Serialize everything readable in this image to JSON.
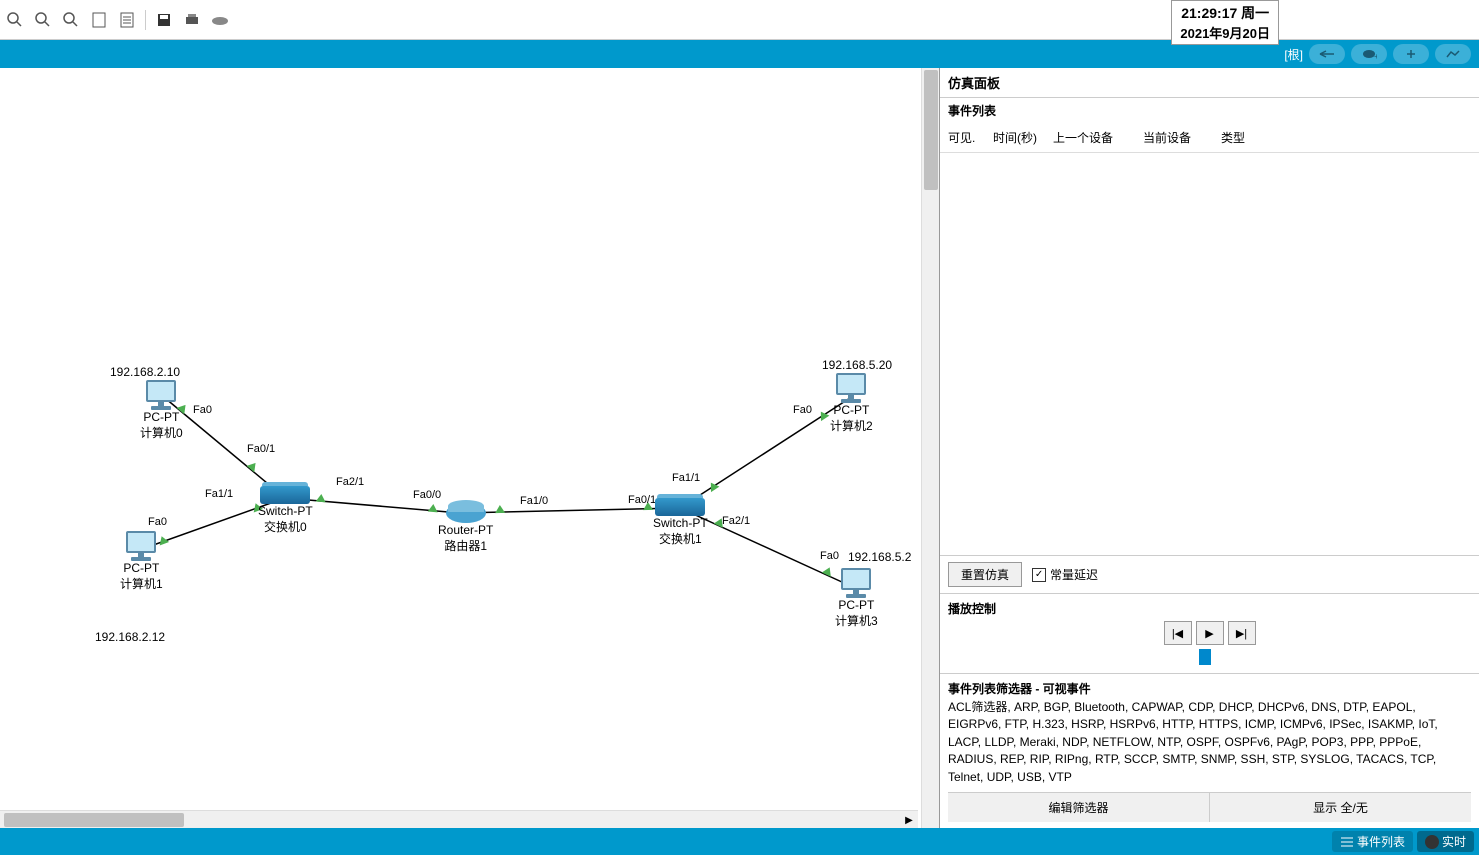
{
  "clock": {
    "time": "21:29:17 周一",
    "date": "2021年9月20日"
  },
  "blueBar": {
    "root": "[根]"
  },
  "devices": {
    "pc0": {
      "type": "PC-PT",
      "name": "计算机0",
      "ip": "192.168.2.10"
    },
    "pc1": {
      "type": "PC-PT",
      "name": "计算机1",
      "ip": "192.168.2.12"
    },
    "pc2": {
      "type": "PC-PT",
      "name": "计算机2",
      "ip": "192.168.5.20"
    },
    "pc3": {
      "type": "PC-PT",
      "name": "计算机3",
      "ip": "192.168.5.2"
    },
    "sw0": {
      "type": "Switch-PT",
      "name": "交换机0"
    },
    "sw1": {
      "type": "Switch-PT",
      "name": "交换机1"
    },
    "rt1": {
      "type": "Router-PT",
      "name": "路由器1"
    }
  },
  "ports": {
    "pc0_fa0": "Fa0",
    "pc1_fa0": "Fa0",
    "pc2_fa0": "Fa0",
    "pc3_fa0": "Fa0",
    "sw0_fa01": "Fa0/1",
    "sw0_fa11": "Fa1/1",
    "sw0_fa21": "Fa2/1",
    "sw1_fa01": "Fa0/1",
    "sw1_fa11": "Fa1/1",
    "sw1_fa21": "Fa2/1",
    "rt_fa00": "Fa0/0",
    "rt_fa10": "Fa1/0"
  },
  "sim": {
    "panelTitle": "仿真面板",
    "eventListTitle": "事件列表",
    "cols": {
      "visible": "可见.",
      "time": "时间(秒)",
      "prev": "上一个设备",
      "curr": "当前设备",
      "type": "类型"
    },
    "reset": "重置仿真",
    "constDelay": "常量延迟",
    "playTitle": "播放控制",
    "filterTitle": "事件列表筛选器 - 可视事件",
    "filterList": "ACL筛选器, ARP, BGP, Bluetooth, CAPWAP, CDP, DHCP, DHCPv6, DNS, DTP, EAPOL, EIGRPv6, FTP, H.323, HSRP, HSRPv6, HTTP, HTTPS, ICMP, ICMPv6, IPSec, ISAKMP, IoT, LACP, LLDP, Meraki, NDP, NETFLOW, NTP, OSPF, OSPFv6, PAgP, POP3, PPP, PPPoE, RADIUS, REP, RIP, RIPng, RTP, SCCP, SMTP, SNMP, SSH, STP, SYSLOG, TACACS, TCP, Telnet, UDP, USB, VTP",
    "editFilter": "编辑筛选器",
    "showAll": "显示 全/无"
  },
  "bottomBar": {
    "eventList": "事件列表",
    "realtime": "实时"
  }
}
